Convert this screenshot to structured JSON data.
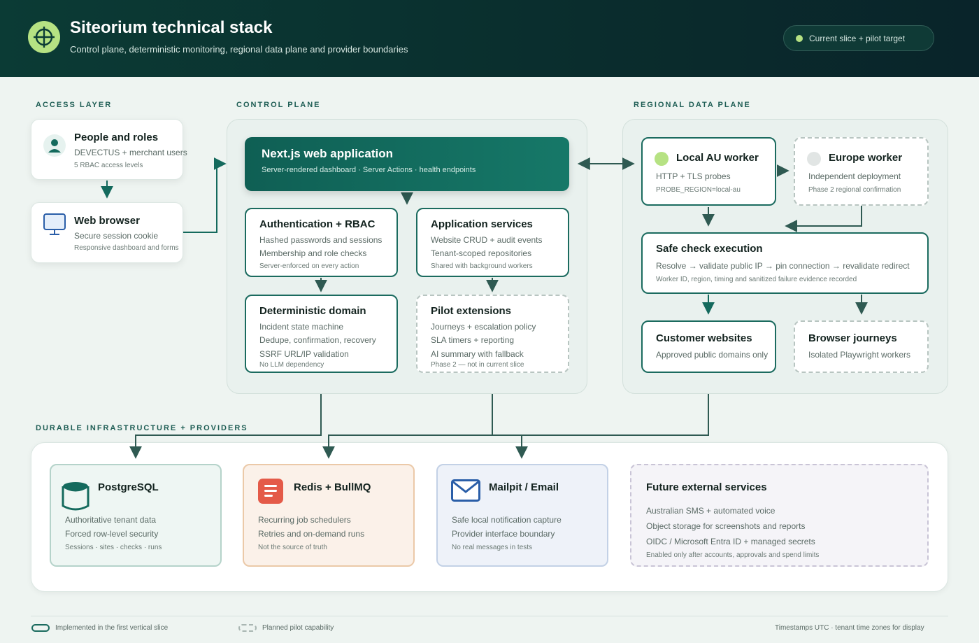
{
  "header": {
    "title": "Siteorium technical stack",
    "subtitle": "Control plane, deterministic monitoring, regional data plane and provider boundaries",
    "status_pill": "Current slice + pilot target"
  },
  "sections": {
    "access": "ACCESS LAYER",
    "control": "CONTROL PLANE",
    "regional": "REGIONAL DATA PLANE",
    "infra": "DURABLE INFRASTRUCTURE + PROVIDERS"
  },
  "access": {
    "people": {
      "title": "People and roles",
      "line1": "DEVECTUS + merchant users",
      "line2": "5 RBAC access levels"
    },
    "browser": {
      "title": "Web browser",
      "line1": "Secure session cookie",
      "line2": "Responsive dashboard and forms"
    }
  },
  "control": {
    "nextjs": {
      "title": "Next.js web application",
      "line1": "Server-rendered dashboard · Server Actions · health endpoints"
    },
    "auth": {
      "title": "Authentication + RBAC",
      "line1": "Hashed passwords and sessions",
      "line2": "Membership and role checks",
      "line3": "Server-enforced on every action"
    },
    "app": {
      "title": "Application services",
      "line1": "Website CRUD + audit events",
      "line2": "Tenant-scoped repositories",
      "line3": "Shared with background workers"
    },
    "domain": {
      "title": "Deterministic domain",
      "line1": "Incident state machine",
      "line2": "Dedupe, confirmation, recovery",
      "line3": "SSRF URL/IP validation",
      "line4": "No LLM dependency"
    },
    "pilot": {
      "title": "Pilot extensions",
      "line1": "Journeys + escalation policy",
      "line2": "SLA timers + reporting",
      "line3": "AI summary with fallback",
      "line4": "Phase 2 — not in current slice"
    }
  },
  "regional": {
    "au": {
      "title": "Local AU worker",
      "line1": "HTTP + TLS probes",
      "line2": "PROBE_REGION=local-au"
    },
    "eu": {
      "title": "Europe worker",
      "line1": "Independent deployment",
      "line2": "Phase 2 regional confirmation"
    },
    "safe": {
      "title": "Safe check execution",
      "line1": "Resolve → validate public IP → pin connection → revalidate redirect",
      "line2": "Worker ID, region, timing and sanitized failure evidence recorded"
    },
    "customer": {
      "title": "Customer websites",
      "line1": "Approved public domains only"
    },
    "journeys": {
      "title": "Browser journeys",
      "line1": "Isolated Playwright workers"
    }
  },
  "infra": {
    "postgres": {
      "title": "PostgreSQL",
      "line1": "Authoritative tenant data",
      "line2": "Forced row-level security",
      "line3": "Sessions · sites · checks · runs"
    },
    "redis": {
      "title": "Redis + BullMQ",
      "line1": "Recurring job schedulers",
      "line2": "Retries and on-demand runs",
      "line3": "Not the source of truth"
    },
    "mail": {
      "title": "Mailpit / Email",
      "line1": "Safe local notification capture",
      "line2": "Provider interface boundary",
      "line3": "No real messages in tests"
    },
    "future": {
      "title": "Future external services",
      "line1": "Australian SMS + automated voice",
      "line2": "Object storage for screenshots and reports",
      "line3": "OIDC / Microsoft Entra ID + managed secrets",
      "line4": "Enabled only after accounts, approvals and spend limits"
    }
  },
  "footer": {
    "legend_solid": "Implemented in the first vertical slice",
    "legend_dashed": "Planned pilot capability",
    "note": "Timestamps UTC · tenant time zones for display"
  },
  "colors": {
    "accent": "#1b6b5f",
    "lime": "#b6e283",
    "header_bg": "#0b3b35",
    "redis": "#e45a48",
    "mail": "#2a5ea8"
  },
  "icons": [
    "target-icon",
    "person-icon",
    "monitor-icon",
    "database-icon",
    "stack-icon",
    "envelope-icon"
  ]
}
